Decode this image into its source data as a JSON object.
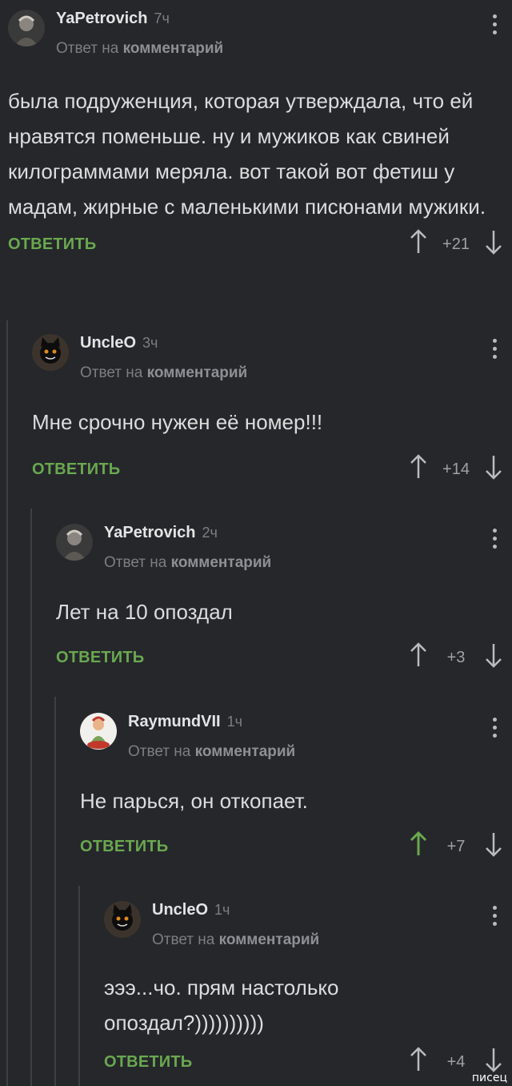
{
  "comments": [
    {
      "author": "YaPetrovich",
      "time": "7ч",
      "reply_prefix": "Ответ на",
      "reply_link": "комментарий",
      "text": "была подруженция, которая утверждала, что ей нравятся поменьше. ну и мужиков как свиней килограммами меряла. вот такой вот фетиш у мадам, жирные с маленькими писюнами мужики.",
      "reply_label": "ОТВЕТИТЬ",
      "rating": "+21",
      "avatar_icon": "person-photo-avatar-icon",
      "upvoted": false
    },
    {
      "author": "UncleO",
      "time": "3ч",
      "reply_prefix": "Ответ на",
      "reply_link": "комментарий",
      "text": "Мне срочно нужен её номер!!!",
      "reply_label": "ОТВЕТИТЬ",
      "rating": "+14",
      "avatar_icon": "black-cat-avatar-icon",
      "upvoted": false
    },
    {
      "author": "YaPetrovich",
      "time": "2ч",
      "reply_prefix": "Ответ на",
      "reply_link": "комментарий",
      "text": "Лет на 10 опоздал",
      "reply_label": "ОТВЕТИТЬ",
      "rating": "+3",
      "avatar_icon": "person-photo-avatar-icon",
      "upvoted": false
    },
    {
      "author": "RaymundVII",
      "time": "1ч",
      "reply_prefix": "Ответ на",
      "reply_link": "комментарий",
      "text": "Не парься, он откопает.",
      "reply_label": "ОТВЕТИТЬ",
      "rating": "+7",
      "avatar_icon": "cartoon-character-avatar-icon",
      "upvoted": true
    },
    {
      "author": "UncleO",
      "time": "1ч",
      "reply_prefix": "Ответ на",
      "reply_link": "комментарий",
      "text": "эээ...чо. прям настолько опоздал?))))))))))",
      "reply_label": "ОТВЕТИТЬ",
      "rating": "+4",
      "avatar_icon": "black-cat-avatar-icon",
      "upvoted": false
    }
  ],
  "watermark": "писец",
  "colors": {
    "background": "#25272b",
    "reply_green": "#6aa84f",
    "muted": "#7b7e83",
    "upvote_active": "#6aa84f"
  }
}
